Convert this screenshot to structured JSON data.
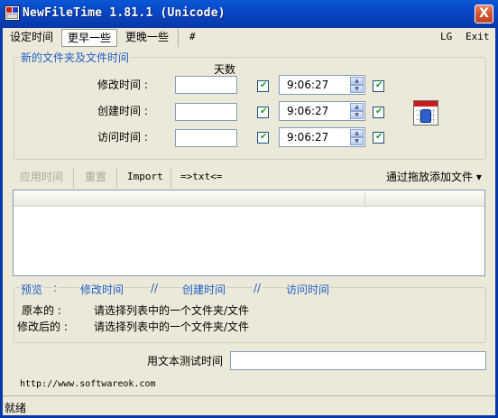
{
  "window": {
    "title": "NewFileTime 1.81.1 (Unicode)",
    "close_glyph": "X"
  },
  "menu": {
    "set_time": "设定时间",
    "earlier": "更早一些",
    "later": "更晚一些",
    "hash": "#",
    "lg": "LG",
    "exit": "Exit"
  },
  "group": {
    "title": "新的文件夹及文件时间",
    "days_header": "天数",
    "rows": [
      {
        "label": "修改时间 :",
        "days": "",
        "days_checked": true,
        "time": "9:06:27",
        "time_checked": true
      },
      {
        "label": "创建时间 :",
        "days": "",
        "days_checked": true,
        "time": "9:06:27",
        "time_checked": true
      },
      {
        "label": "访问时间 :",
        "days": "",
        "days_checked": true,
        "time": "9:06:27",
        "time_checked": true
      }
    ]
  },
  "toolbar": {
    "apply": "应用时间",
    "reset": "重置",
    "import": "Import",
    "to_txt": "=>txt<=",
    "add_files": "通过拖放添加文件 ▾"
  },
  "preview": {
    "tab_preview": "预览",
    "colon": ":",
    "tab_modified": "修改时间",
    "sep1": "//",
    "tab_created": "创建时间",
    "sep2": "//",
    "tab_accessed": "访问时间",
    "original_label": "原本的 :",
    "original_value": "请选择列表中的一个文件夹/文件",
    "modified_label": "修改后的 :",
    "modified_value": "请选择列表中的一个文件夹/文件"
  },
  "test": {
    "label": "用文本测试时间",
    "value": ""
  },
  "footer": {
    "url": "http://www.softwareok.com"
  },
  "status": {
    "text": "就绪"
  },
  "colors": {
    "title_bar": "#0845c4",
    "accent_text": "#1d5ec7",
    "check": "#21a121",
    "window_bg": "#ECE9D8"
  }
}
